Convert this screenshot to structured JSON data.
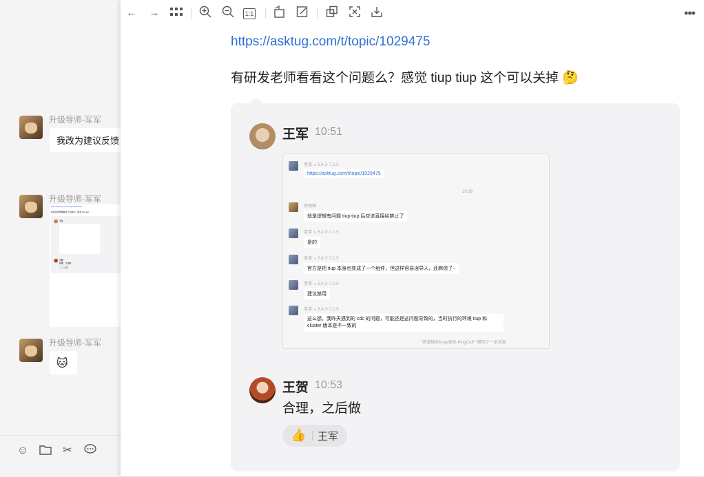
{
  "chat": {
    "messages": [
      {
        "sender": "升级导师-军军",
        "text": "我改为建议反馈"
      },
      {
        "sender": "升级导师-军军",
        "text": ""
      },
      {
        "sender": "升级导师-军军",
        "text": ""
      }
    ],
    "mini_link": "https://asktug.com/t/topic/1029475",
    "mini_question": "有研发老师看看这个问题么？感觉 tiup tiup ...",
    "mini_name1": "王军",
    "mini_name2": "王贺",
    "mini_reply": "合理，之后做",
    "mini_react": "王军"
  },
  "toolbar_left": {
    "icons": [
      "emoji-icon",
      "folder-icon",
      "scissors-icon",
      "chat-icon"
    ]
  },
  "viewer_toolbar": {
    "icons": [
      "back-icon",
      "forward-icon",
      "grid-icon",
      "zoom-in-icon",
      "zoom-out-icon",
      "actual-size-icon",
      "rotate-icon",
      "edit-icon",
      "copy-icon",
      "crop-icon",
      "download-icon",
      "more-icon"
    ],
    "actual_size_label": "1:1"
  },
  "content": {
    "link": "https://asktug.com/t/topic/1029475",
    "question": "有研发老师看看这个问题么？感觉 tiup tiup 这个可以关掉 🤔",
    "first": {
      "name": "王军",
      "time": "10:51"
    },
    "screenshot": {
      "messages": [
        {
          "sender": "老苗 ↘ 5.4.3~7.1.5",
          "text": "https://asktug.com/t/topic/1029475"
        },
        {
          "sender": "",
          "text": ""
        },
        {
          "sender": "贺桐桐",
          "text": "就是逻辑有问题 tiup tiup 后应该直接给禁止了"
        },
        {
          "sender": "老苗 ↘ 5.4.3~7.1.5",
          "text": "是的"
        },
        {
          "sender": "老苗 ↘ 5.4.3~7.1.5",
          "text": "官方是把 tiup 本身也变成了一个组件，但这样容易误导人，还麻烦了~"
        },
        {
          "sender": "老苗 ↘ 5.4.3~7.1.5",
          "text": "建议禁用"
        },
        {
          "sender": "老苗 ↘ 5.4.3~7.1.5",
          "text": "这么想，我昨天遇到的 cdc 的问题，可能还是这问题导致的，当时执行的环境 tiup 和 cluster 版本是不一致的"
        }
      ],
      "time": "10:38",
      "footer": "\"表漫禅Billmay表妹-PingCAP\" 撤回了一条消息"
    },
    "second": {
      "name": "王贺",
      "time": "10:53",
      "reply": "合理，之后做"
    },
    "reaction": {
      "emoji": "👍",
      "user": "王军"
    }
  }
}
